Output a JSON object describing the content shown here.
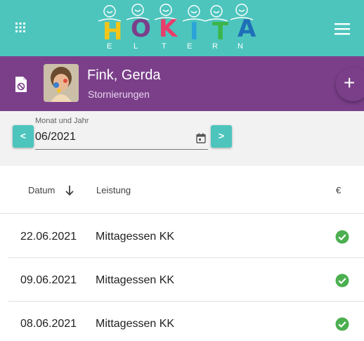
{
  "header": {
    "logo_letters": [
      "H",
      "O",
      "K",
      "I",
      "T",
      "A"
    ],
    "logo_colors": [
      "#f5c518",
      "#7b3f8a",
      "#e83e6c",
      "#29a3d9",
      "#3cb54a",
      "#1f6fb8"
    ],
    "logo_sub": [
      "E",
      "L",
      "T",
      "E",
      "R",
      "N"
    ],
    "bar_color": "#4dc5bd"
  },
  "profile": {
    "name": "Fink, Gerda",
    "subtitle": "Stornierungen",
    "fab_label": "+",
    "bar_color": "#7b3f8a"
  },
  "month": {
    "label": "Monat und Jahr",
    "value": "06/2021",
    "prev_label": "<",
    "next_label": ">"
  },
  "table": {
    "columns": {
      "date": "Datum",
      "service": "Leistung",
      "amount": "€"
    },
    "rows": [
      {
        "date": "22.06.2021",
        "service": "Mittagessen KK",
        "status": "check"
      },
      {
        "date": "09.06.2021",
        "service": "Mittagessen KK",
        "status": "check"
      },
      {
        "date": "08.06.2021",
        "service": "Mittagessen KK",
        "status": "check"
      }
    ],
    "check_color": "#4caf50"
  }
}
